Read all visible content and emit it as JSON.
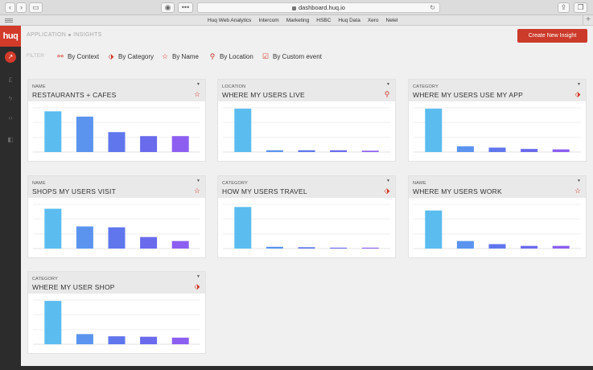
{
  "browser": {
    "url": "dashboard.huq.io",
    "bookmarks": [
      "Huq Web Analytics",
      "Intercom",
      "Marketing",
      "HSBC",
      "Huq Data",
      "Xero",
      "Nelel"
    ]
  },
  "sidebar": {
    "logo": "huq"
  },
  "header": {
    "breadcrumb_1": "APPLICATION",
    "breadcrumb_2": "INSIGHTS",
    "create_button": "Create New Insight"
  },
  "filters": {
    "label": "FILTER",
    "items": [
      {
        "label": "By Context",
        "icon": "share-nodes-icon"
      },
      {
        "label": "By Category",
        "icon": "tag-icon"
      },
      {
        "label": "By Name",
        "icon": "star-icon"
      },
      {
        "label": "By Location",
        "icon": "map-pin-icon"
      },
      {
        "label": "By Custom event",
        "icon": "checkbox-icon"
      }
    ]
  },
  "accent_color": "#d23a2a",
  "bar_colors": [
    "#5bbcef",
    "#5a94ef",
    "#5f76ed",
    "#6a6aed",
    "#8c5ff0"
  ],
  "cards": [
    {
      "kind": "NAME",
      "title": "RESTAURANTS + CAFES",
      "icon": "star-icon"
    },
    {
      "kind": "LOCATION",
      "title": "WHERE MY USERS LIVE",
      "icon": "map-pin-icon"
    },
    {
      "kind": "CATEGORY",
      "title": "WHERE MY USERS USE MY APP",
      "icon": "tag-icon"
    },
    {
      "kind": "NAME",
      "title": "SHOPS MY USERS VISIT",
      "icon": "star-icon"
    },
    {
      "kind": "CATEGORY",
      "title": "HOW MY USERS TRAVEL",
      "icon": "tag-icon"
    },
    {
      "kind": "NAME",
      "title": "WHERE MY USERS WORK",
      "icon": "star-icon"
    },
    {
      "kind": "CATEGORY",
      "title": "WHERE MY USER SHOP",
      "icon": "tag-icon"
    }
  ],
  "chart_data": [
    {
      "type": "bar",
      "values": [
        0.92,
        0.8,
        0.45,
        0.36,
        0.36
      ],
      "ylim": [
        0,
        1
      ],
      "grid": true
    },
    {
      "type": "bar",
      "values": [
        0.98,
        0.04,
        0.04,
        0.04,
        0.03
      ],
      "ylim": [
        0,
        1
      ],
      "grid": true
    },
    {
      "type": "bar",
      "values": [
        0.98,
        0.13,
        0.1,
        0.07,
        0.06
      ],
      "ylim": [
        0,
        1
      ],
      "grid": true
    },
    {
      "type": "bar",
      "values": [
        0.9,
        0.5,
        0.48,
        0.26,
        0.17
      ],
      "ylim": [
        0,
        1
      ],
      "grid": true
    },
    {
      "type": "bar",
      "values": [
        0.94,
        0.04,
        0.03,
        0.02,
        0.02
      ],
      "ylim": [
        0,
        1
      ],
      "grid": true
    },
    {
      "type": "bar",
      "values": [
        0.86,
        0.17,
        0.1,
        0.06,
        0.06
      ],
      "ylim": [
        0,
        1
      ],
      "grid": true
    },
    {
      "type": "bar",
      "values": [
        0.98,
        0.23,
        0.18,
        0.17,
        0.15
      ],
      "ylim": [
        0,
        1
      ],
      "grid": true
    }
  ]
}
